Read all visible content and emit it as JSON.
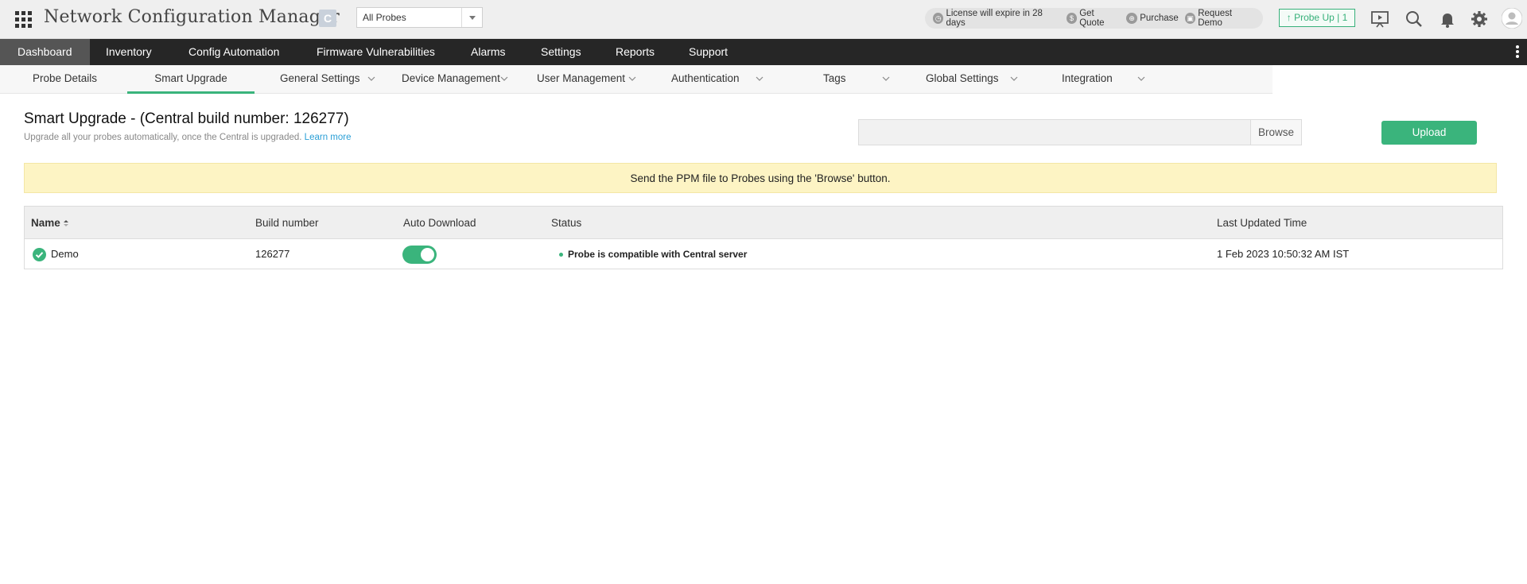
{
  "header": {
    "app_title": "Network Configuration Manager",
    "edition_badge": "C",
    "probe_select": {
      "selected": "All Probes"
    },
    "license_bar": [
      {
        "icon": "clock-icon",
        "label": "License will expire in 28 days"
      },
      {
        "icon": "dollar-icon",
        "label": "Get Quote"
      },
      {
        "icon": "cart-icon",
        "label": "Purchase"
      },
      {
        "icon": "demo-icon",
        "label": "Request Demo"
      }
    ],
    "probe_up": "↑ Probe Up | 1",
    "icons": [
      "presentation-icon",
      "search-icon",
      "bell-icon",
      "gear-icon",
      "avatar-icon"
    ]
  },
  "main_nav": {
    "items": [
      "Dashboard",
      "Inventory",
      "Config Automation",
      "Firmware Vulnerabilities",
      "Alarms",
      "Settings",
      "Reports",
      "Support"
    ],
    "active": "Dashboard"
  },
  "sub_nav": {
    "tabs": [
      "Probe Details",
      "Smart Upgrade",
      "General Settings",
      "Device Management",
      "User Management",
      "Authentication",
      "Tags",
      "Global Settings",
      "Integration"
    ],
    "active": "Smart Upgrade"
  },
  "page": {
    "title": "Smart Upgrade - (Central build number: 126277)",
    "subtitle": "Upgrade all your probes automatically, once the Central is upgraded.",
    "learn_more": "Learn more",
    "file_value": "",
    "browse_label": "Browse",
    "upload_label": "Upload",
    "banner": "Send the PPM file to Probes using the 'Browse' button."
  },
  "table": {
    "columns": [
      "Name",
      "Build number",
      "Auto Download",
      "Status",
      "Last Updated Time"
    ],
    "sort": {
      "column": "Name",
      "direction": "ascending"
    },
    "rows": [
      {
        "name": "Demo",
        "build_number": "126277",
        "auto_download": true,
        "status": "Probe is compatible with Central server",
        "last_updated": "1 Feb 2023 10:50:32 AM IST"
      }
    ]
  },
  "colors": {
    "accent": "#3ab47c",
    "nav_bg": "#262626",
    "nav_active": "#555555",
    "banner_bg": "#fdf4c4",
    "link": "#2a9fd6"
  }
}
